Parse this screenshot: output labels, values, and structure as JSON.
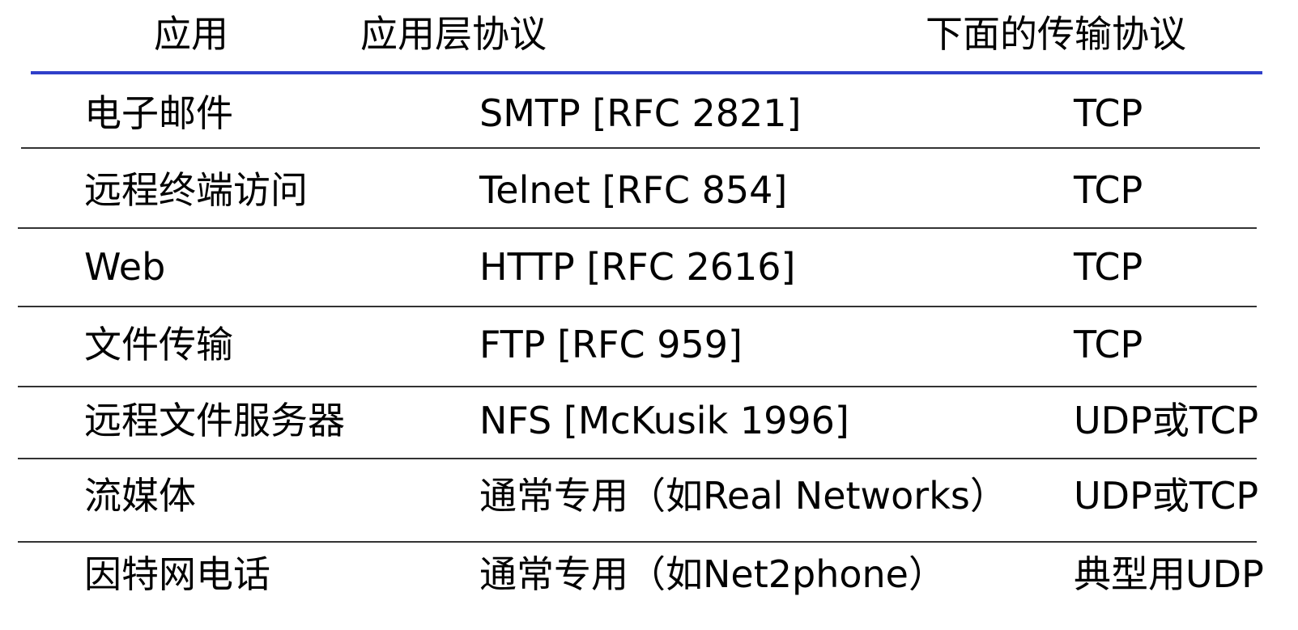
{
  "header": {
    "application": "应用",
    "app_layer_protocol": "应用层协议",
    "transport_protocol": "下面的传输协议"
  },
  "colors": {
    "header_rule": "#2f3fc9",
    "row_rule": "#333333",
    "text": "#000000"
  },
  "rows": [
    {
      "application": "电子邮件",
      "protocol": "SMTP [RFC 2821]",
      "transport": "TCP"
    },
    {
      "application": "远程终端访问",
      "protocol": "Telnet [RFC 854]",
      "transport": "TCP"
    },
    {
      "application": "Web",
      "protocol": "HTTP [RFC 2616]",
      "transport": "TCP"
    },
    {
      "application": "文件传输",
      "protocol": "FTP [RFC 959]",
      "transport": "TCP"
    },
    {
      "application": "远程文件服务器",
      "protocol": "NFS [McKusik 1996]",
      "transport": "UDP或TCP"
    },
    {
      "application": "流媒体",
      "protocol": "通常专用（如Real Networks）",
      "transport": "UDP或TCP"
    },
    {
      "application": "因特网电话",
      "protocol": "通常专用（如Net2phone）",
      "transport": "典型用UDP"
    }
  ]
}
